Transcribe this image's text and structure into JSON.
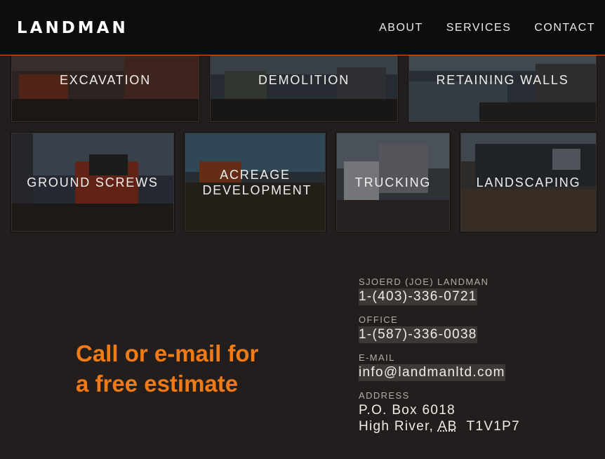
{
  "header": {
    "logo": "LANDMAN",
    "nav": [
      {
        "label": "ABOUT"
      },
      {
        "label": "SERVICES"
      },
      {
        "label": "CONTACT"
      }
    ]
  },
  "services": {
    "row1": [
      {
        "label": "EXCAVATION"
      },
      {
        "label": "DEMOLITION"
      },
      {
        "label": "RETAINING WALLS"
      }
    ],
    "row2": [
      {
        "label": "GROUND SCREWS"
      },
      {
        "label": "ACREAGE DEVELOPMENT"
      },
      {
        "label": "TRUCKING"
      },
      {
        "label": "LANDSCAPING"
      }
    ]
  },
  "cta": {
    "line1": "Call or e-mail for",
    "line2": "a free estimate"
  },
  "contact": {
    "owner_label": "SJOERD (JOE) LANDMAN",
    "owner_phone": "1-(403)-336-0721",
    "office_label": "OFFICE",
    "office_phone": "1-(587)-336-0038",
    "email_label": "E-MAIL",
    "email": "info@landmanltd.com",
    "address_label": "ADDRESS",
    "address_line1": "P.O. Box 6018",
    "address_city": "High River,",
    "address_province": "AB",
    "address_postal": "T1V1P7"
  },
  "colors": {
    "accent": "#f07a16",
    "header_bg": "#0b0d0f",
    "page_bg": "#221e1d"
  }
}
